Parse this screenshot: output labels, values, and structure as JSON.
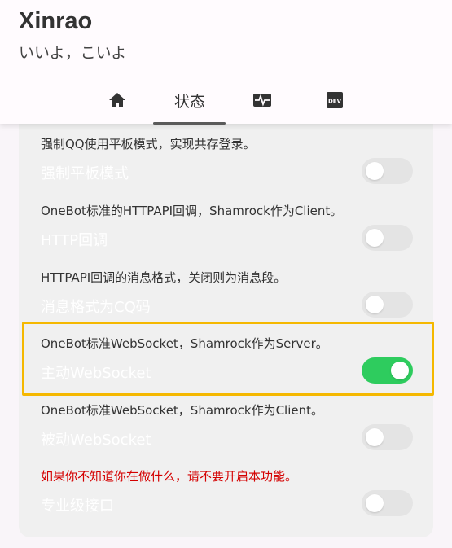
{
  "app": {
    "title": "Xinrao",
    "subtitle": "いいよ，こいよ"
  },
  "tabs": [
    {
      "id": "home",
      "icon": "home-icon"
    },
    {
      "id": "status",
      "label": "状态",
      "selected": true
    },
    {
      "id": "monitor",
      "icon": "heartbeat-monitor-icon"
    },
    {
      "id": "dev",
      "icon": "dev-icon",
      "icon_text": "DEV"
    }
  ],
  "settings": [
    {
      "desc": "强制QQ使用平板模式，实现共存登录。",
      "title": "强制平板模式",
      "enabled": false
    },
    {
      "desc": "OneBot标准的HTTPAPI回调，Shamrock作为Client。",
      "title": "HTTP回调",
      "enabled": false
    },
    {
      "desc": "HTTPAPI回调的消息格式，关闭则为消息段。",
      "title": "消息格式为CQ码",
      "enabled": false
    },
    {
      "desc": "OneBot标准WebSocket，Shamrock作为Server。",
      "title": "主动WebSocket",
      "enabled": true
    },
    {
      "desc": "OneBot标准WebSocket，Shamrock作为Client。",
      "title": "被动WebSocket",
      "enabled": false
    },
    {
      "desc": "如果你不知道你在做什么，请不要开启本功能。",
      "title": "专业级接口",
      "enabled": false,
      "warning": true
    }
  ],
  "colors": {
    "switch_on": "#2ecc5e",
    "switch_off": "#e4e4e4",
    "highlight": "#f5b800",
    "warning_text": "#d40000"
  }
}
